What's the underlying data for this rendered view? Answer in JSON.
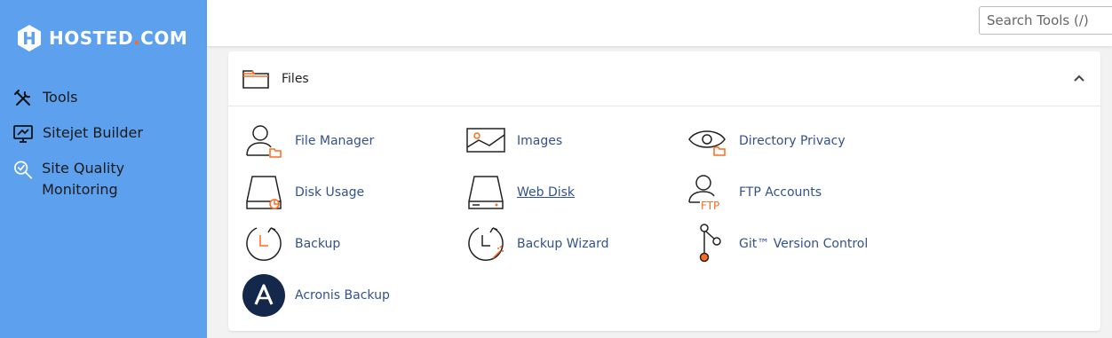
{
  "brand": {
    "name_main": "HOSTED",
    "name_dot": ".",
    "name_tld": "COM",
    "accent": "#ff6a1f",
    "sidebar_bg": "#5da1ee"
  },
  "sidebar": {
    "items": [
      {
        "label": "Tools",
        "icon": "tools-icon"
      },
      {
        "label": "Sitejet Builder",
        "icon": "monitor-icon"
      },
      {
        "label": "Site Quality Monitoring",
        "icon": "magnifier-check-icon"
      }
    ]
  },
  "header": {
    "search_placeholder": "Search Tools (/)"
  },
  "panel": {
    "title": "Files",
    "tools": [
      {
        "label": "File Manager",
        "icon": "user-folder-icon"
      },
      {
        "label": "Images",
        "icon": "image-icon"
      },
      {
        "label": "Directory Privacy",
        "icon": "eye-folder-icon"
      },
      {
        "label": "Disk Usage",
        "icon": "disk-usage-icon"
      },
      {
        "label": "Web Disk",
        "icon": "web-disk-icon"
      },
      {
        "label": "FTP Accounts",
        "icon": "ftp-user-icon"
      },
      {
        "label": "Backup",
        "icon": "clock-icon"
      },
      {
        "label": "Backup Wizard",
        "icon": "clock-wand-icon"
      },
      {
        "label": "Git™ Version Control",
        "icon": "git-branch-icon"
      },
      {
        "label": "Acronis Backup",
        "icon": "acronis-icon"
      }
    ]
  }
}
